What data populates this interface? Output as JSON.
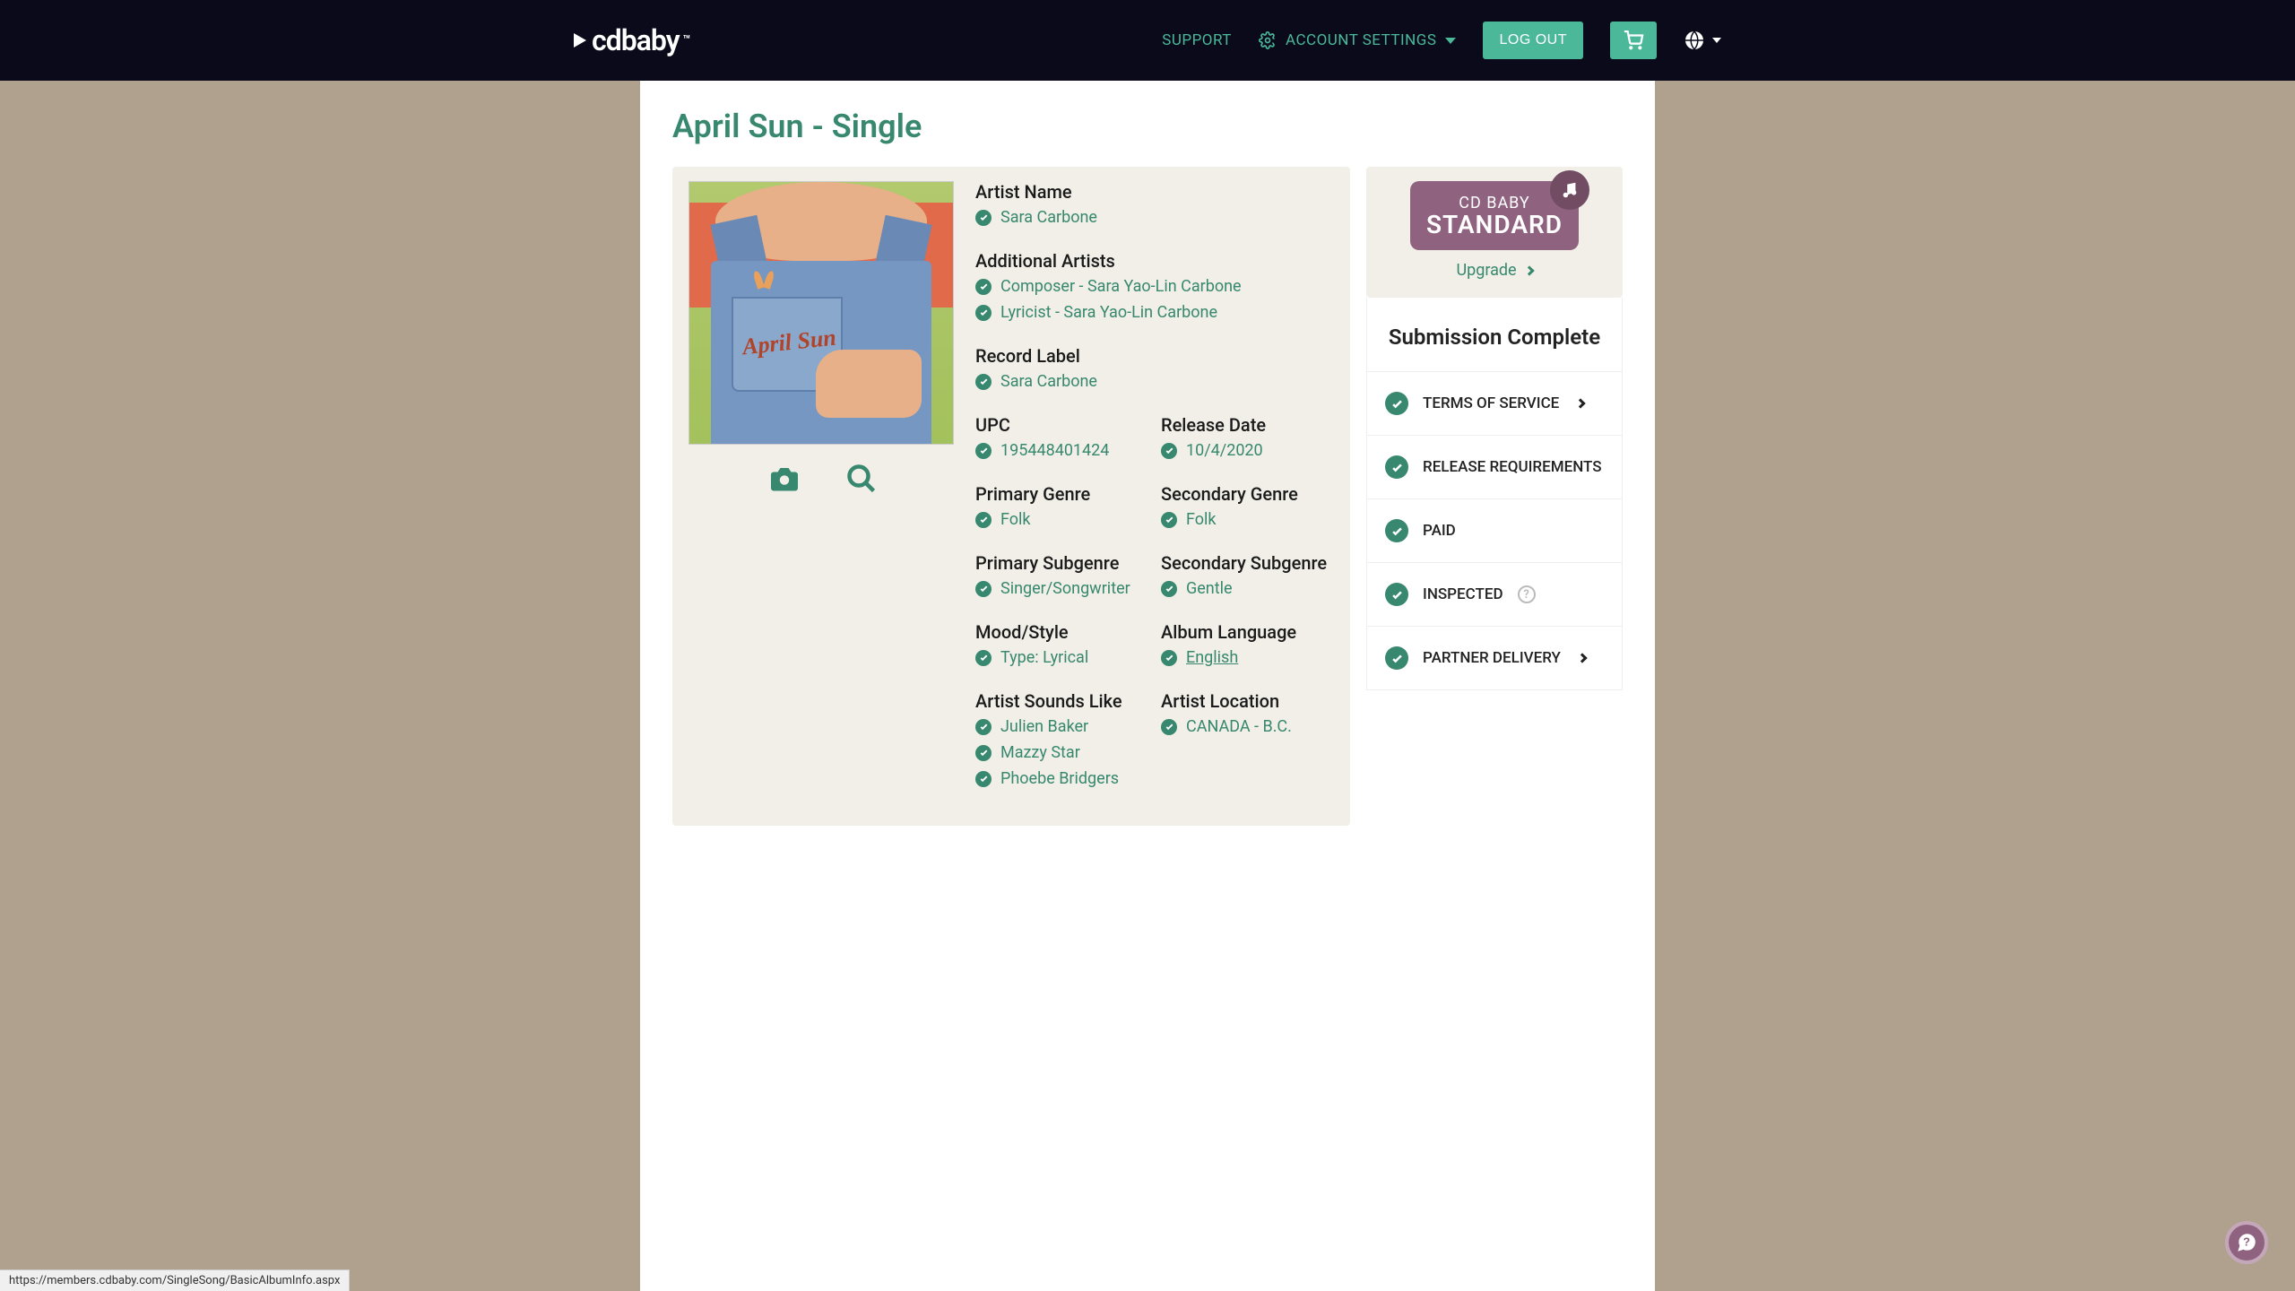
{
  "header": {
    "brand": "cdbaby",
    "support": "SUPPORT",
    "account": "ACCOUNT SETTINGS",
    "logout": "LOG OUT"
  },
  "page": {
    "title": "April Sun - Single"
  },
  "artwork": {
    "title_on_art": "April Sun"
  },
  "details": {
    "artist_name": {
      "label": "Artist Name",
      "values": [
        "Sara Carbone"
      ]
    },
    "additional_artists": {
      "label": "Additional Artists",
      "values": [
        "Composer - Sara Yao-Lin Carbone",
        "Lyricist - Sara Yao-Lin Carbone"
      ]
    },
    "record_label": {
      "label": "Record Label",
      "values": [
        "Sara Carbone"
      ]
    },
    "upc": {
      "label": "UPC",
      "values": [
        "195448401424"
      ]
    },
    "release_date": {
      "label": "Release Date",
      "values": [
        "10/4/2020"
      ]
    },
    "primary_genre": {
      "label": "Primary Genre",
      "values": [
        "Folk"
      ]
    },
    "secondary_genre": {
      "label": "Secondary Genre",
      "values": [
        "Folk"
      ]
    },
    "primary_subgenre": {
      "label": "Primary Subgenre",
      "values": [
        "Singer/Songwriter"
      ]
    },
    "secondary_subgenre": {
      "label": "Secondary Subgenre",
      "values": [
        "Gentle"
      ]
    },
    "mood_style": {
      "label": "Mood/Style",
      "values": [
        "Type: Lyrical"
      ]
    },
    "album_language": {
      "label": "Album Language",
      "values": [
        "English"
      ]
    },
    "artist_sounds_like": {
      "label": "Artist Sounds Like",
      "values": [
        "Julien Baker",
        "Mazzy Star",
        "Phoebe Bridgers"
      ]
    },
    "artist_location": {
      "label": "Artist Location",
      "values": [
        "CANADA - B.C."
      ]
    }
  },
  "sidebar": {
    "tier_line1": "CD BABY",
    "tier_line2": "STANDARD",
    "upgrade": "Upgrade",
    "submission_title": "Submission Complete",
    "checklist": [
      {
        "label": "TERMS OF SERVICE",
        "chevron": true
      },
      {
        "label": "RELEASE REQUIREMENTS",
        "chevron": false
      },
      {
        "label": "PAID",
        "chevron": false
      },
      {
        "label": "INSPECTED",
        "chevron": false,
        "help": true
      },
      {
        "label": "PARTNER DELIVERY",
        "chevron": true
      }
    ]
  },
  "status_url": "https://members.cdbaby.com/SingleSong/BasicAlbumInfo.aspx"
}
